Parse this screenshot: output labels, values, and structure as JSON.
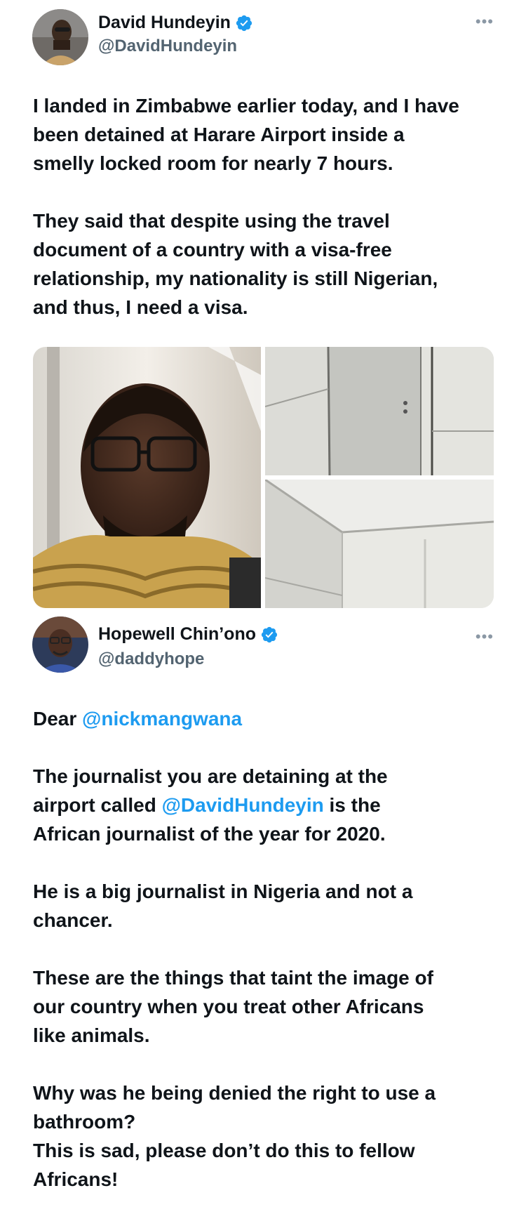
{
  "tweet1": {
    "author_name": "David Hundeyin",
    "handle": "@DavidHundeyin",
    "more_icon": "•••",
    "lines": [
      "I landed in Zimbabwe earlier today, and I have",
      "been detained at Harare Airport inside a",
      "smelly locked room for nearly 7 hours.",
      "They said that despite using the travel",
      "document of a country with a visa-free",
      "relationship, my nationality is still Nigerian,",
      "and thus, I need a visa."
    ]
  },
  "tweet2": {
    "author_name": "Hopewell Chin’ono",
    "handle": "@daddyhope",
    "more_icon": "•••",
    "greeting": "Dear ",
    "greeting_mention": "@nickmangwana",
    "p1_line1": "The journalist you are detaining at the",
    "p1_line2_pre": "airport called ",
    "p1_line2_mention": "@DavidHundeyin",
    "p1_line2_post": " is the",
    "p1_line3": "African journalist of the year for 2020.",
    "p2_line1": "He is a big journalist in Nigeria and not a",
    "p2_line2": "chancer.",
    "p3_line1": "These are the things that taint the image of",
    "p3_line2": "our country when you treat other Africans",
    "p3_line3": "like animals.",
    "p4_line1": "Why was he being denied the right to use a",
    "p4_line2": "bathroom?",
    "p4_line3": "This is sad, please don’t do this to fellow",
    "p4_line4": "Africans!"
  },
  "colors": {
    "text": "#0f1419",
    "secondary": "#536471",
    "mention": "#1d9bf0",
    "verified": "#1d9bf0"
  }
}
